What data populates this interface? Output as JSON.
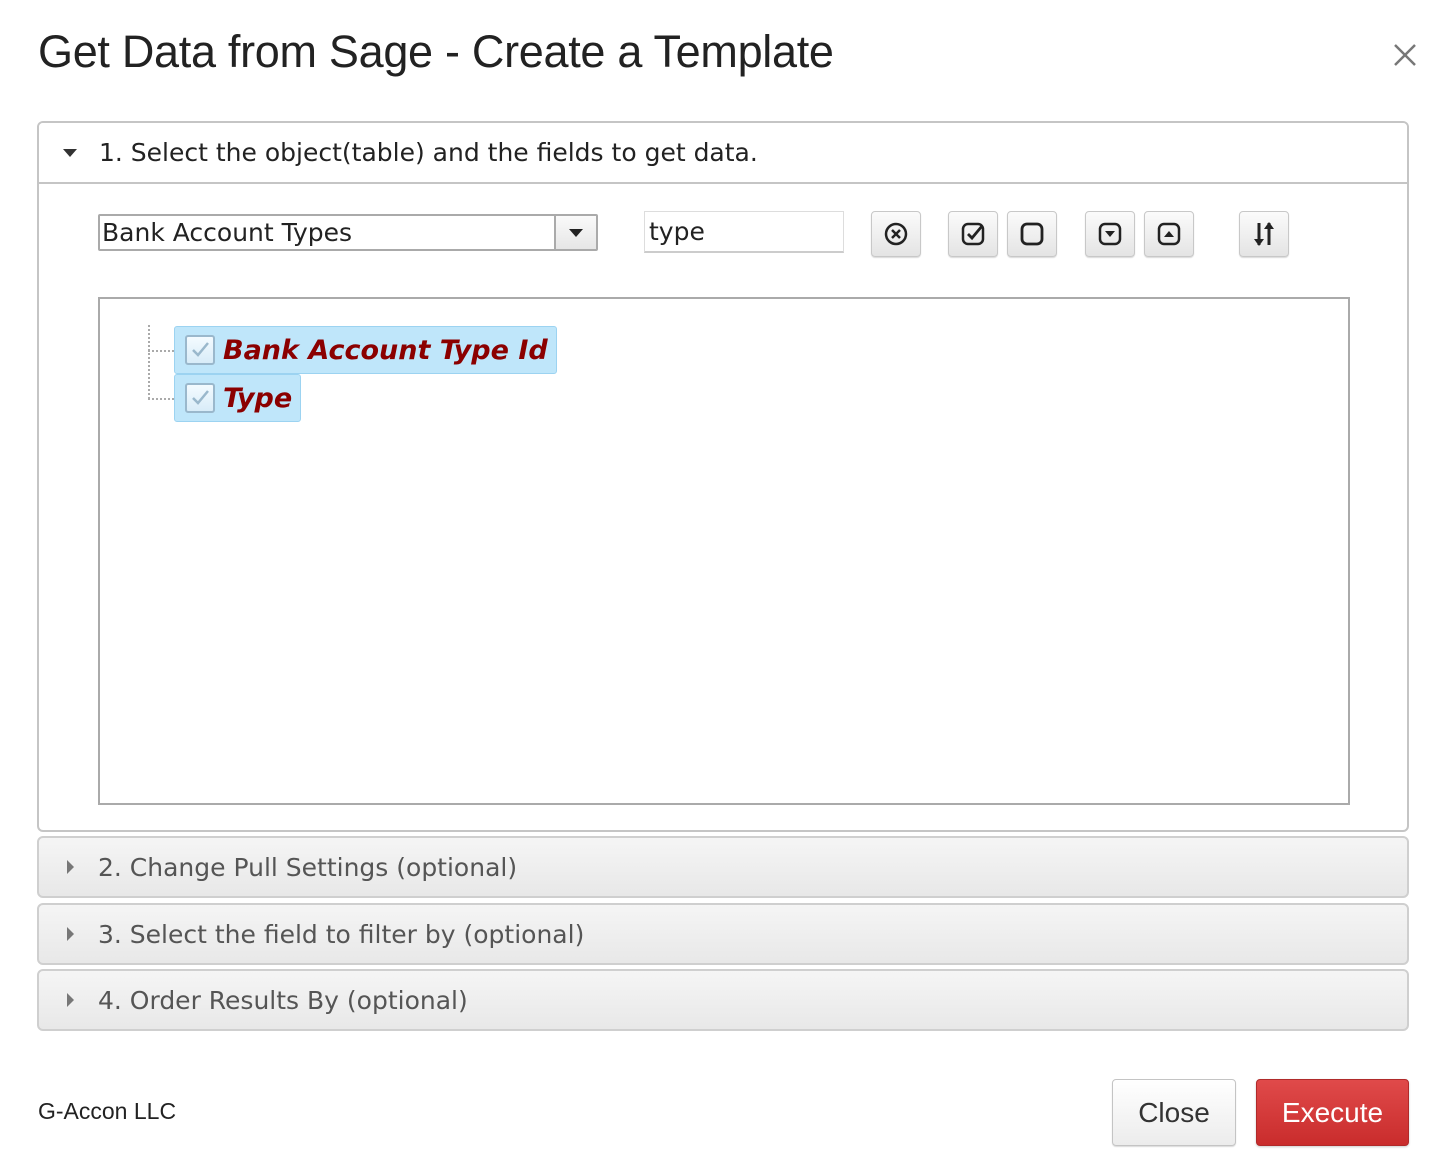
{
  "dialog": {
    "title": "Get Data from Sage - Create a Template",
    "close_icon": "close-icon"
  },
  "sections": [
    {
      "label": "1. Select the object(table) and the fields to get data.",
      "expanded": true
    },
    {
      "label": "2. Change Pull Settings (optional)",
      "expanded": false
    },
    {
      "label": "3. Select the field to filter by (optional)",
      "expanded": false
    },
    {
      "label": "4. Order Results By (optional)",
      "expanded": false
    }
  ],
  "object_select": {
    "selected": "Bank Account Types"
  },
  "search": {
    "value": "type"
  },
  "toolbar": {
    "icons": [
      "clear-search-icon",
      "check-all-icon",
      "uncheck-all-icon",
      "expand-icon",
      "collapse-icon",
      "sort-icon"
    ]
  },
  "tree": {
    "nodes": [
      {
        "label": "Bank Account Type Id",
        "checked": true
      },
      {
        "label": "Type",
        "checked": true
      }
    ]
  },
  "footer": {
    "company": "G-Accon LLC",
    "close_label": "Close",
    "execute_label": "Execute"
  },
  "colors": {
    "execute": "#d13b3b",
    "node_highlight": "#bfe6fa",
    "node_text": "#8b0000"
  }
}
